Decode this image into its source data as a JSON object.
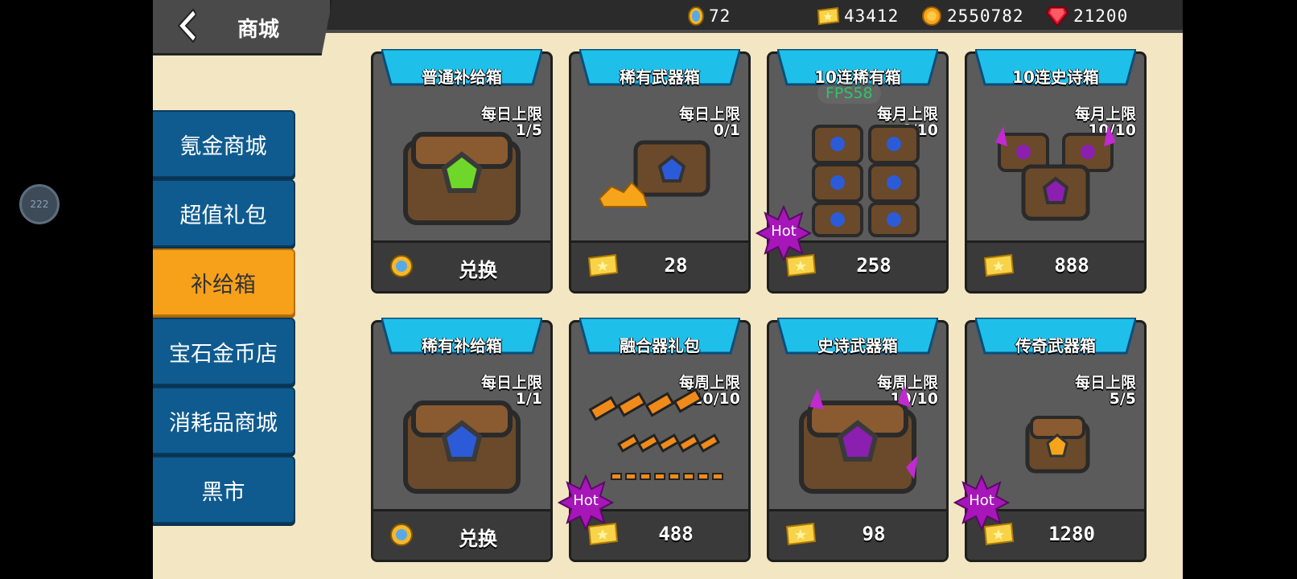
{
  "header": {
    "title": "商城",
    "resources": [
      {
        "icon": "gold-medal-icon",
        "value": "72"
      },
      {
        "icon": "ticket-icon",
        "value": "43412"
      },
      {
        "icon": "gold-coin-icon",
        "value": "2550782"
      },
      {
        "icon": "red-gem-icon",
        "value": "21200"
      }
    ]
  },
  "sidebar": {
    "items": [
      {
        "label": "氪金商城",
        "active": false
      },
      {
        "label": "超值礼包",
        "active": false
      },
      {
        "label": "补给箱",
        "active": true
      },
      {
        "label": "宝石金币店",
        "active": false
      },
      {
        "label": "消耗品商城",
        "active": false
      },
      {
        "label": "黑市",
        "active": false
      }
    ]
  },
  "overlay": {
    "fps": "FPS58",
    "floating_button": "222"
  },
  "cards": [
    {
      "name": "普通补给箱",
      "limit_label": "每日上限",
      "limit": "1/5",
      "price_type": "medal",
      "price": "兑换",
      "hot": false
    },
    {
      "name": "稀有武器箱",
      "limit_label": "每日上限",
      "limit": "0/1",
      "price_type": "ticket",
      "price": "28",
      "hot": false
    },
    {
      "name": "10连稀有箱",
      "limit_label": "每月上限",
      "limit": "6/10",
      "price_type": "ticket",
      "price": "258",
      "hot": true
    },
    {
      "name": "10连史诗箱",
      "limit_label": "每月上限",
      "limit": "10/10",
      "price_type": "ticket",
      "price": "888",
      "hot": false
    },
    {
      "name": "稀有补给箱",
      "limit_label": "每日上限",
      "limit": "1/1",
      "price_type": "medal",
      "price": "兑换",
      "hot": false
    },
    {
      "name": "融合器礼包",
      "limit_label": "每周上限",
      "limit": "10/10",
      "price_type": "ticket",
      "price": "488",
      "hot": true
    },
    {
      "name": "史诗武器箱",
      "limit_label": "每周上限",
      "limit": "10/10",
      "price_type": "ticket",
      "price": "98",
      "hot": false
    },
    {
      "name": "传奇武器箱",
      "limit_label": "每日上限",
      "limit": "5/5",
      "price_type": "ticket",
      "price": "1280",
      "hot": true
    }
  ],
  "hot_label": "Hot",
  "colors": {
    "sidebar_bg": "#0f5b8f",
    "sidebar_active": "#f7a11a",
    "banner": "#1ec0ea",
    "card_bg": "#5b5b5b",
    "page_bg": "#f2e6c3",
    "hot_badge": "#a616b8"
  }
}
